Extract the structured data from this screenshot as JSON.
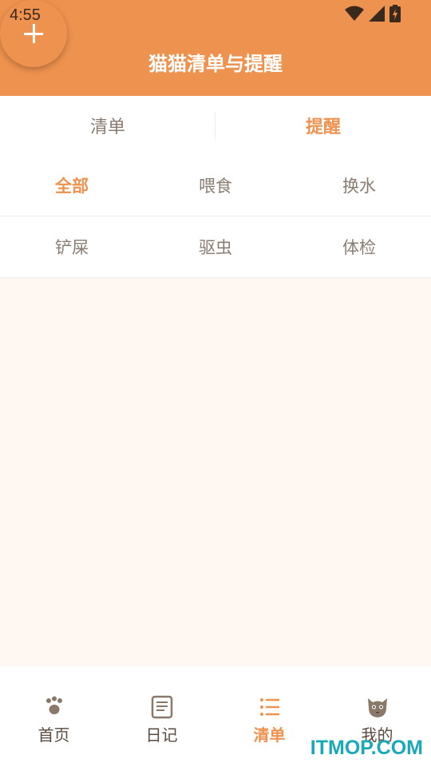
{
  "status_bar": {
    "time": "4:55",
    "icons": [
      "wifi-icon",
      "cell-signal-icon",
      "battery-charging-icon"
    ]
  },
  "header": {
    "title": "猫猫清单与提醒",
    "fab_icon": "plus-icon",
    "color": "#EE924F"
  },
  "tabs": [
    {
      "label": "清单",
      "active": false
    },
    {
      "label": "提醒",
      "active": true
    }
  ],
  "categories": [
    {
      "label": "全部",
      "active": true
    },
    {
      "label": "喂食",
      "active": false
    },
    {
      "label": "换水",
      "active": false
    },
    {
      "label": "铲屎",
      "active": false
    },
    {
      "label": "驱虫",
      "active": false
    },
    {
      "label": "体检",
      "active": false
    }
  ],
  "bottom_nav": [
    {
      "label": "首页",
      "icon": "paw-icon",
      "active": false
    },
    {
      "label": "日记",
      "icon": "notebook-icon",
      "active": false
    },
    {
      "label": "清单",
      "icon": "list-icon",
      "active": true
    },
    {
      "label": "我的",
      "icon": "cat-face-icon",
      "active": false
    }
  ],
  "watermark": "ITMOP.COM",
  "colors": {
    "accent": "#EE924F",
    "content_bg": "#FFF7F1",
    "text_muted": "#8A7C70"
  }
}
